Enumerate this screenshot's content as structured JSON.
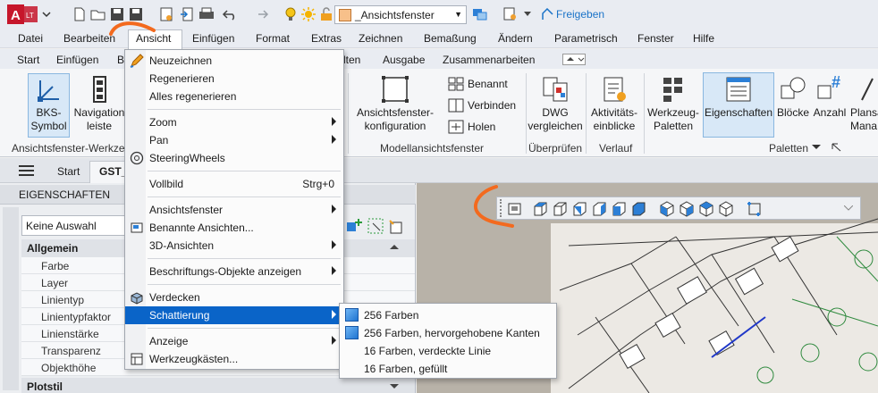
{
  "app": {
    "logo_text": "A",
    "logo_badge": "LT"
  },
  "titlebar": {
    "workspace_value": "_Ansichtsfenster",
    "share_label": "Freigeben"
  },
  "menubar": {
    "items": [
      "Datei",
      "Bearbeiten",
      "Ansicht",
      "Einfügen",
      "Format",
      "Extras",
      "Zeichnen",
      "Bemaßung",
      "Ändern",
      "Parametrisch",
      "Fenster",
      "Hilfe"
    ]
  },
  "ribbon_tabs": [
    "Start",
    "Einfügen",
    "Be",
    "lten",
    "Ausgabe",
    "Zusammenarbeiten"
  ],
  "ribbon": {
    "bks_label_1": "BKS-",
    "bks_label_2": "Symbol",
    "nav_label_1": "Navigation",
    "nav_label_2": "leiste",
    "panel_left": "Ansichtsfenster-Werkze",
    "vpconf_1": "Ansichtsfenster-",
    "vpconf_2": "konfiguration",
    "named": "Benannt",
    "join": "Verbinden",
    "restore": "Holen",
    "panel_model": "Modellansichtsfenster",
    "dwg_1": "DWG",
    "dwg_2": "vergleichen",
    "panel_compare": "Überprüfen",
    "act_1": "Aktivitäts-",
    "act_2": "einblicke",
    "panel_history": "Verlauf",
    "tp_1": "Werkzeug-",
    "tp_2": "Paletten",
    "props": "Eigenschaften",
    "blocks": "Blöcke",
    "count": "Anzahl",
    "plan_1": "Plansa",
    "plan_2": "Mana",
    "panel_palettes": "Paletten"
  },
  "docbar": {
    "home": "Start",
    "doc": "GST_"
  },
  "properties": {
    "title": "EIGENSCHAFTEN",
    "selection": "Keine Auswahl",
    "group_general": "Allgemein",
    "rows": [
      "Farbe",
      "Layer",
      "Linientyp",
      "Linientypfaktor",
      "Linienstärke",
      "Transparenz",
      "Objekthöhe"
    ],
    "group_plot": "Plotstil"
  },
  "dropdown": {
    "items": [
      {
        "label": "Neuzeichnen"
      },
      {
        "label": "Regenerieren"
      },
      {
        "label": "Alles regenerieren"
      },
      {
        "label": "Zoom"
      },
      {
        "label": "Pan"
      },
      {
        "label": "SteeringWheels"
      },
      {
        "label": "Vollbild",
        "shortcut": "Strg+0"
      },
      {
        "label": "Ansichtsfenster"
      },
      {
        "label": "Benannte Ansichten..."
      },
      {
        "label": "3D-Ansichten"
      },
      {
        "label": "Beschriftungs-Objekte anzeigen"
      },
      {
        "label": "Verdecken"
      },
      {
        "label": "Schattierung"
      },
      {
        "label": "Anzeige"
      },
      {
        "label": "Werkzeugkästen..."
      }
    ]
  },
  "submenu": {
    "items": [
      {
        "label": "256 Farben"
      },
      {
        "label": "256 Farben, hervorgehobene Kanten"
      },
      {
        "label": "16 Farben, verdeckte Linie"
      },
      {
        "label": "16 Farben, gefüllt"
      }
    ]
  },
  "colors": {
    "accent": "#0a64c8",
    "annotation": "#f36a1e"
  }
}
